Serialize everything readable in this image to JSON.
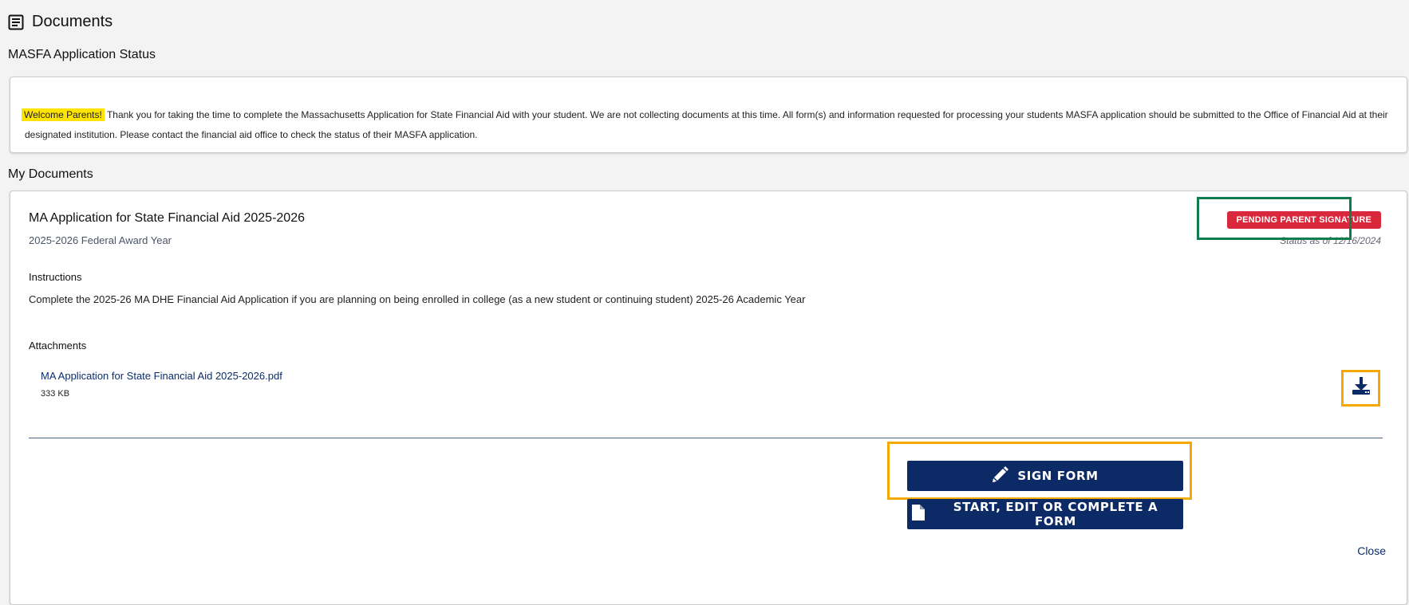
{
  "header": {
    "title": "Documents",
    "icon": "document-list-icon"
  },
  "status_section": {
    "label": "MASFA Application Status",
    "highlight": "Welcome Parents!",
    "message": "Thank you for taking the time to complete the Massachusetts Application for State Financial Aid with your student. We are not collecting documents at this time. All form(s) and information requested for processing your students MASFA application should be submitted to the Office of Financial Aid at their designated institution. Please contact the financial aid office to check the status of their MASFA application."
  },
  "my_documents": {
    "label": "My Documents",
    "document": {
      "title": "MA Application for State Financial Aid 2025-2026",
      "subtitle": "2025-2026 Federal Award Year",
      "status_badge": "PENDING PARENT SIGNATURE",
      "status_date": "Status as of 12/16/2024",
      "instructions_label": "Instructions",
      "instructions_text": "Complete the 2025-26 MA DHE Financial Aid Application if you are planning on being enrolled in college (as a new student or continuing student) 2025-26 Academic Year",
      "attachments_label": "Attachments",
      "attachment": {
        "name": "MA Application for State Financial Aid 2025-2026.pdf",
        "size": "333 KB",
        "icon": "download-icon"
      },
      "buttons": {
        "sign": "SIGN FORM",
        "sign_icon": "pencil-icon",
        "start": "START, EDIT OR COMPLETE A FORM",
        "start_icon": "file-icon"
      },
      "close_label": "Close"
    }
  },
  "colors": {
    "primary": "#0c2a66",
    "badge": "#d9283c",
    "callout_green": "#0f7b4f",
    "callout_orange": "#f2a900",
    "highlight": "#ffe400"
  }
}
